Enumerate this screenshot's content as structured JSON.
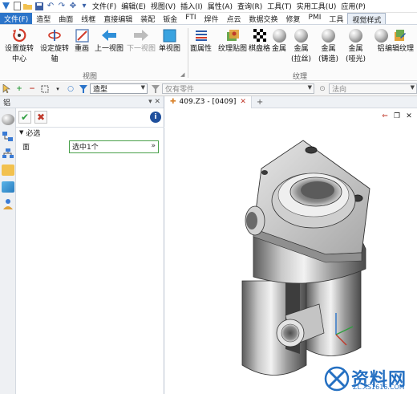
{
  "menubar": {
    "file_menu": "文件(F)",
    "items": [
      "编辑(E)",
      "视图(V)",
      "插入(I)",
      "属性(A)",
      "查询(R)",
      "工具(T)",
      "实用工具(U)",
      "应用(P)"
    ]
  },
  "ribbon_tabs": {
    "file_tab": "文件(F)",
    "items": [
      "造型",
      "曲面",
      "线框",
      "直接编辑",
      "装配",
      "钣金",
      "FTI",
      "焊件",
      "点云",
      "数据交换",
      "修复",
      "PMI",
      "工具"
    ],
    "selected_tab": "视觉样式"
  },
  "ribbon": {
    "view_group": {
      "buttons": [
        {
          "label1": "设置旋转",
          "label2": "中心"
        },
        {
          "label1": "设定旋转",
          "label2": "轴"
        },
        {
          "label1": "重画",
          "label2": ""
        },
        {
          "label1": "上一视图",
          "label2": ""
        },
        {
          "label1": "下一视图",
          "label2": ""
        },
        {
          "label1": "单视图",
          "label2": ""
        }
      ],
      "label": "视图"
    },
    "texture_group": {
      "buttons": [
        {
          "label1": "面属性",
          "label2": ""
        },
        {
          "label1": "纹理贴图",
          "label2": ""
        },
        {
          "label1": "棋盘格",
          "label2": ""
        },
        {
          "label1": "金属",
          "label2": ""
        },
        {
          "label1": "金属",
          "label2": "(拉丝)"
        },
        {
          "label1": "金属",
          "label2": "(铸造)"
        },
        {
          "label1": "金属",
          "label2": "(哑光)"
        },
        {
          "label1": "铝",
          "label2": ""
        },
        {
          "label1": "编辑纹理",
          "label2": ""
        }
      ],
      "label": "纹理"
    }
  },
  "toolbar": {
    "filter_value": "造型",
    "scope_value": "仅有零件",
    "normal_value": "法向"
  },
  "panel": {
    "title": "铝",
    "section_label": "必选",
    "field_label": "面",
    "field_value": "选中1个"
  },
  "document": {
    "tab_label": "409.Z3 - [0409]"
  },
  "watermark": {
    "brand": "资料网",
    "url": "ZL.XS1616.COM"
  },
  "colors": {
    "accent": "#2c74c9",
    "watermark": "#2570c2",
    "confirm": "#2f9e3f",
    "cancel": "#c0392b"
  }
}
